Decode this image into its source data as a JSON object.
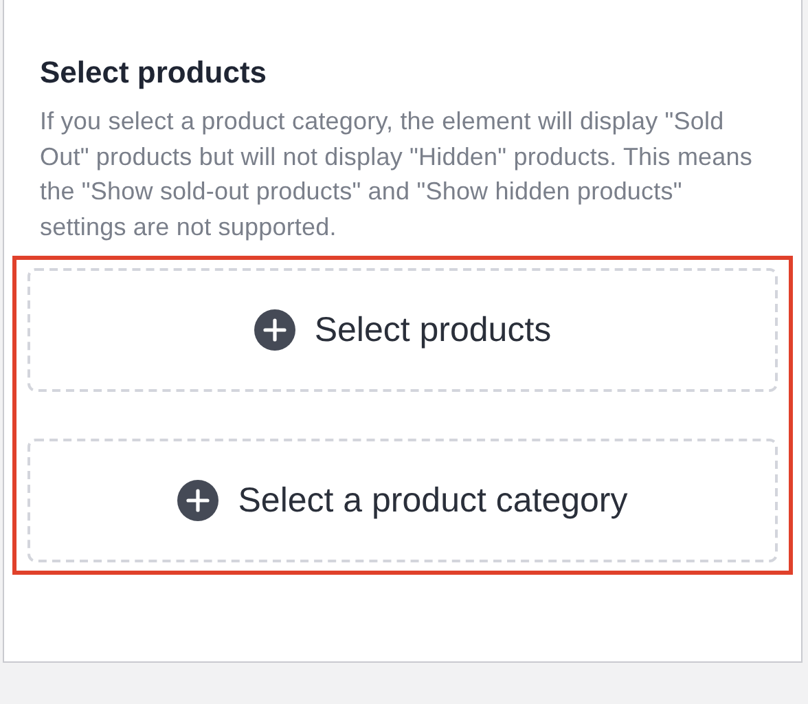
{
  "section": {
    "title": "Select products",
    "description": "If you select a product category, the element will display \"Sold Out\" products but will not display \"Hidden\" products. This means the \"Show sold-out products\" and \"Show hidden products\" settings are not supported.",
    "actions": [
      {
        "label": "Select products"
      },
      {
        "label": "Select a product category"
      }
    ]
  }
}
